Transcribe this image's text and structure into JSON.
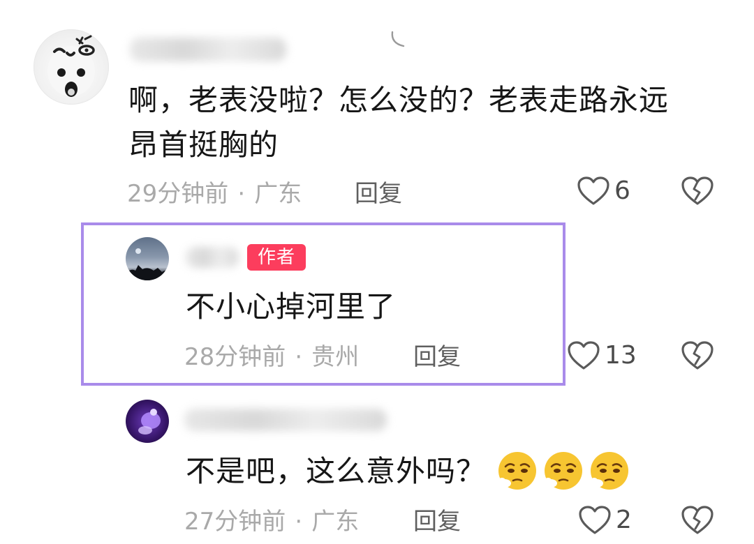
{
  "colors": {
    "highlight_border": "#a98bea",
    "author_badge_bg": "#fc3d5d",
    "meta_text": "#a9a9a9",
    "body_text": "#161616"
  },
  "comments": [
    {
      "text_line1": "啊，老表没啦？怎么没的？老表走路永远",
      "text_line2": "昂首挺胸的",
      "time": "29分钟前",
      "separator": "·",
      "location": "广东",
      "reply_label": "回复",
      "likes": "6",
      "avatar_icon": "cartoon-face-avatar"
    },
    {
      "author_badge": "作者",
      "text_line1": "不小心掉河里了",
      "time": "28分钟前",
      "separator": "·",
      "location": "贵州",
      "reply_label": "回复",
      "likes": "13",
      "avatar_icon": "night-sky-avatar",
      "highlighted": true
    },
    {
      "text_line1": "不是吧，这么意外吗？",
      "emojis": [
        "pleading-face-emoji",
        "pleading-face-emoji",
        "pleading-face-emoji"
      ],
      "time": "27分钟前",
      "separator": "·",
      "location": "广东",
      "reply_label": "回复",
      "likes": "2",
      "avatar_icon": "purple-avatar"
    }
  ],
  "icons": {
    "like": "heart-outline-icon",
    "dislike": "broken-heart-icon"
  }
}
